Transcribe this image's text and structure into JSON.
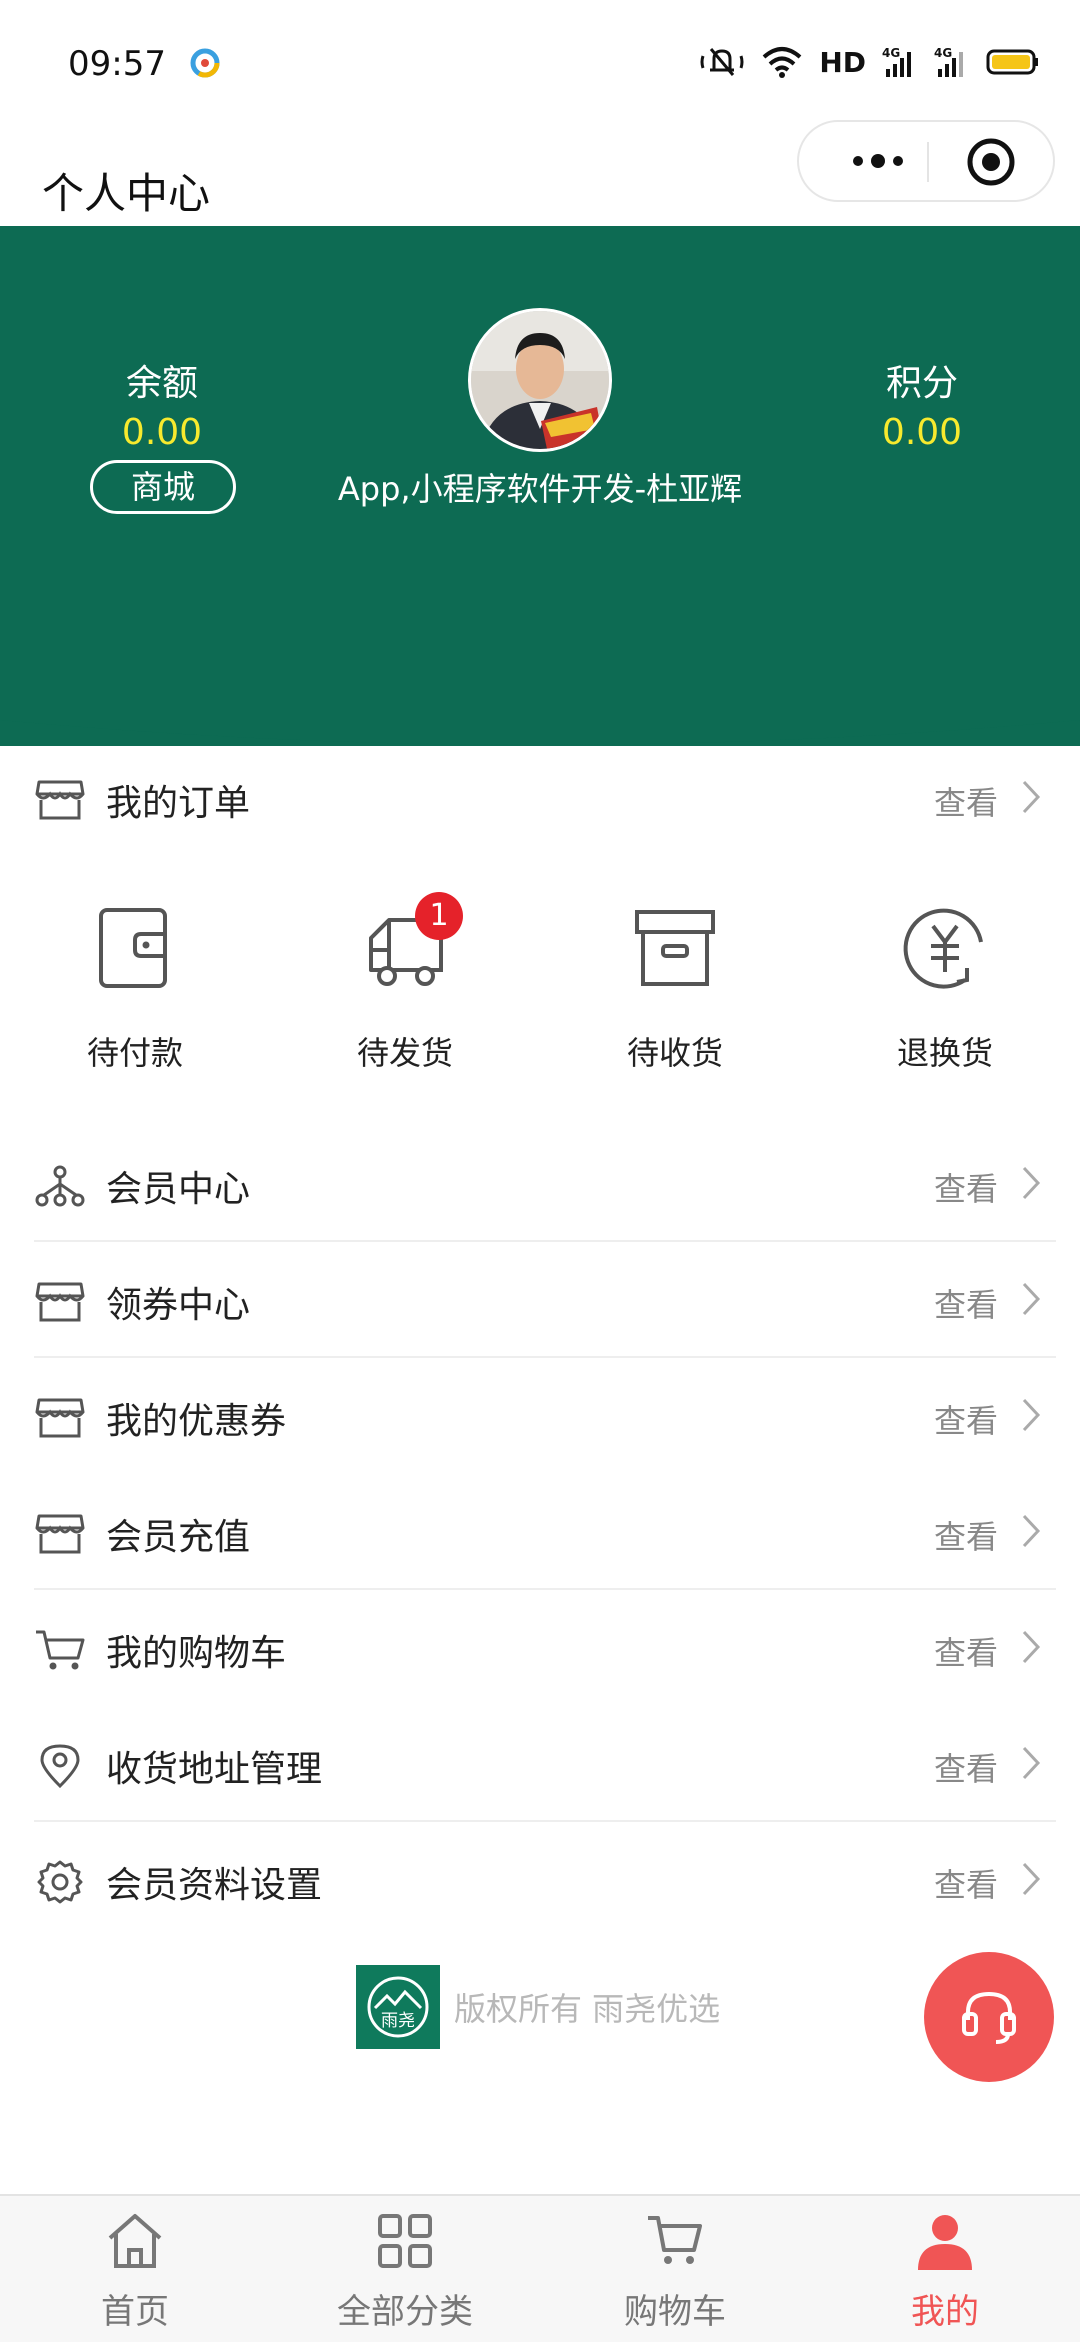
{
  "status_bar": {
    "time": "09:57",
    "network_label": "HD",
    "sim1": "4G",
    "sim2": "4G"
  },
  "nav": {
    "title": "个人中心"
  },
  "profile": {
    "balance_label": "余额",
    "balance_value": "0.00",
    "points_label": "积分",
    "points_value": "0.00",
    "mall_button": "商城",
    "username": "App,小程序软件开发-杜亚辉"
  },
  "orders": {
    "title": "我的订单",
    "more": "查看",
    "items": [
      {
        "label": "待付款",
        "icon": "wallet-icon"
      },
      {
        "label": "待发货",
        "icon": "truck-icon",
        "badge": "1"
      },
      {
        "label": "待收货",
        "icon": "box-icon"
      },
      {
        "label": "退换货",
        "icon": "yen-refund-icon"
      }
    ]
  },
  "menu": [
    {
      "label": "会员中心",
      "more": "查看",
      "icon": "hierarchy-icon"
    },
    {
      "label": "领券中心",
      "more": "查看",
      "icon": "store-icon"
    },
    {
      "label": "我的优惠券",
      "more": "查看",
      "icon": "store-icon"
    },
    {
      "label": "会员充值",
      "more": "查看",
      "icon": "store-icon"
    },
    {
      "label": "我的购物车",
      "more": "查看",
      "icon": "cart-icon"
    },
    {
      "label": "收货地址管理",
      "more": "查看",
      "icon": "location-pin-icon"
    },
    {
      "label": "会员资料设置",
      "more": "查看",
      "icon": "gear-icon"
    }
  ],
  "footer": {
    "copyright": "版权所有 雨尧优选",
    "logo_text": "雨尧"
  },
  "tabs": [
    {
      "label": "首页",
      "icon": "home-icon"
    },
    {
      "label": "全部分类",
      "icon": "grid-icon"
    },
    {
      "label": "购物车",
      "icon": "cart-icon"
    },
    {
      "label": "我的",
      "icon": "person-icon",
      "active": true
    }
  ],
  "colors": {
    "brand_green": "#0d6b53",
    "value_yellow": "#f7ea2e",
    "accent_red": "#f05555",
    "badge_red": "#e5222a"
  }
}
